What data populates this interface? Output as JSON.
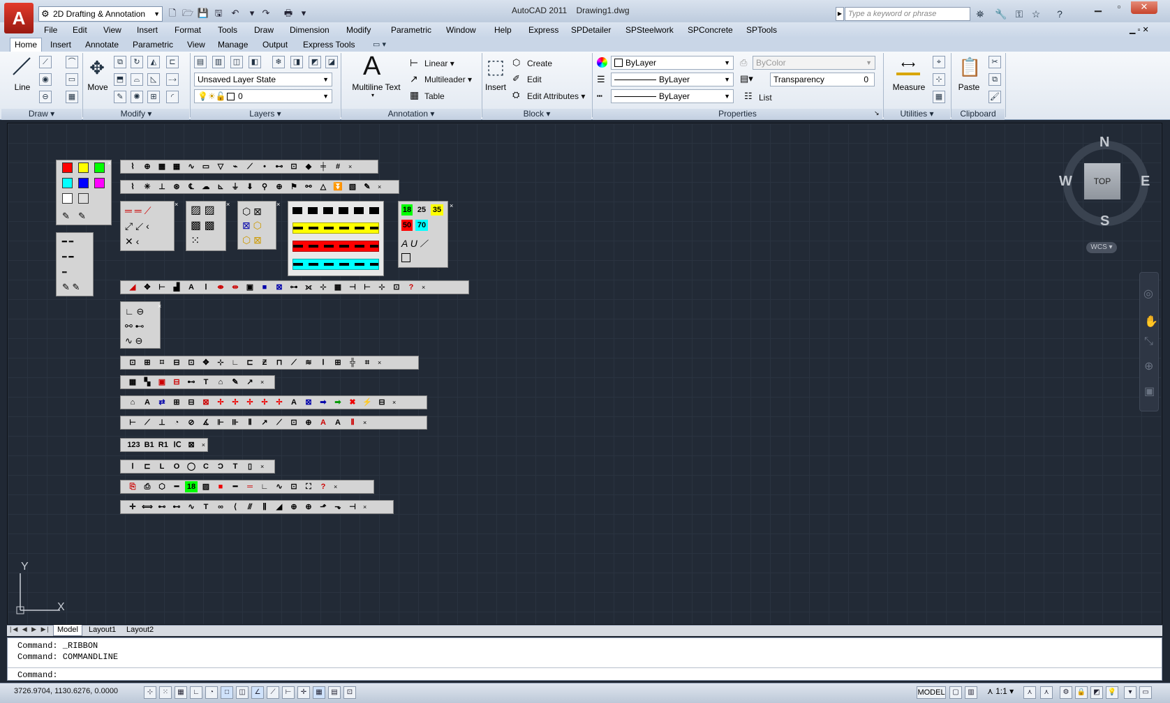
{
  "app": {
    "title": "AutoCAD 2011",
    "document": "Drawing1.dwg",
    "logo": "A",
    "workspace": "2D Drafting & Annotation",
    "search_placeholder": "Type a keyword or phrase"
  },
  "menubar": [
    "File",
    "Edit",
    "View",
    "Insert",
    "Format",
    "Tools",
    "Draw",
    "Dimension",
    "Modify",
    "Parametric",
    "Window",
    "Help",
    "Express",
    "SPDetailer",
    "SPSteelwork",
    "SPConcrete",
    "SPTools"
  ],
  "ribbon_tabs": [
    "Home",
    "Insert",
    "Annotate",
    "Parametric",
    "View",
    "Manage",
    "Output",
    "Express Tools"
  ],
  "ribbon": {
    "draw": {
      "panel": "Draw",
      "line": "Line"
    },
    "modify": {
      "panel": "Modify",
      "move": "Move"
    },
    "layers": {
      "panel": "Layers",
      "layer_state": "Unsaved Layer State",
      "current_layer": "0"
    },
    "annotation": {
      "panel": "Annotation",
      "mtext": "Multiline Text",
      "linear": "Linear",
      "multileader": "Multileader",
      "table": "Table"
    },
    "block": {
      "panel": "Block",
      "insert": "Insert",
      "create": "Create",
      "edit": "Edit",
      "edit_attributes": "Edit Attributes"
    },
    "properties": {
      "panel": "Properties",
      "color": "ByLayer",
      "linetype": "ByLayer",
      "lineweight": "ByLayer",
      "plotstyle": "ByColor",
      "transparency_label": "Transparency",
      "transparency_value": "0",
      "list": "List"
    },
    "utilities": {
      "panel": "Utilities",
      "measure": "Measure"
    },
    "clipboard": {
      "panel": "Clipboard",
      "paste": "Paste"
    }
  },
  "viewcube": {
    "north": "N",
    "south": "S",
    "east": "E",
    "west": "W",
    "face": "TOP",
    "wcs": "WCS"
  },
  "ucs": {
    "x": "X",
    "y": "Y"
  },
  "layout_tabs": [
    "Model",
    "Layout1",
    "Layout2"
  ],
  "command": {
    "line1": "Command: _RIBBON",
    "line2": "Command: COMMANDLINE",
    "prompt": "Command:"
  },
  "status": {
    "coords": "3726.9704, 1130.6276, 0.0000",
    "space": "MODEL",
    "scale": "1:1"
  },
  "textstyle_samples": [
    "18",
    "25",
    "35",
    "50",
    "70"
  ],
  "colors": {
    "accent": "#c7432b",
    "canvas": "#222a36",
    "grid": "#2a3340"
  }
}
